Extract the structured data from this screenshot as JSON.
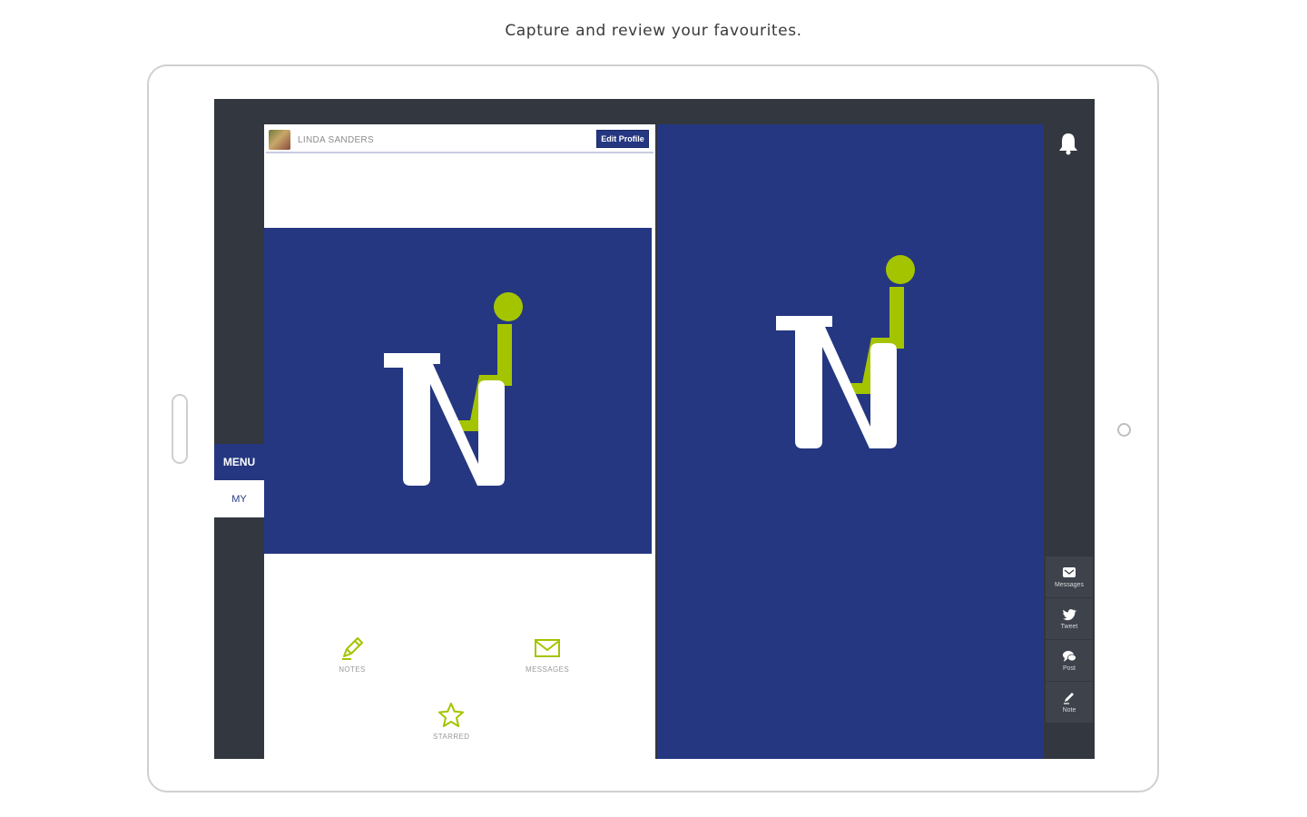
{
  "headline": "Capture and review your favourites.",
  "colors": {
    "brand_blue": "#253781",
    "accent_green": "#a4c400",
    "dark_frame": "#33373f"
  },
  "sidebar": {
    "menu_label": "MENU",
    "my_label": "MY"
  },
  "profile": {
    "username": "LINDA SANDERS",
    "edit_button": "Edit Profile"
  },
  "shortcuts": [
    {
      "label": "NOTES",
      "icon": "pencil-icon"
    },
    {
      "label": "MESSAGES",
      "icon": "envelope-icon"
    },
    {
      "label": "STARRED",
      "icon": "star-icon"
    }
  ],
  "side_actions": [
    {
      "label": "Messages",
      "icon": "message-icon"
    },
    {
      "label": "Tweet",
      "icon": "twitter-icon"
    },
    {
      "label": "Post",
      "icon": "chat-bubbles-icon"
    },
    {
      "label": "Note",
      "icon": "pencil-icon"
    }
  ],
  "notifications": {
    "icon": "bell-icon"
  }
}
